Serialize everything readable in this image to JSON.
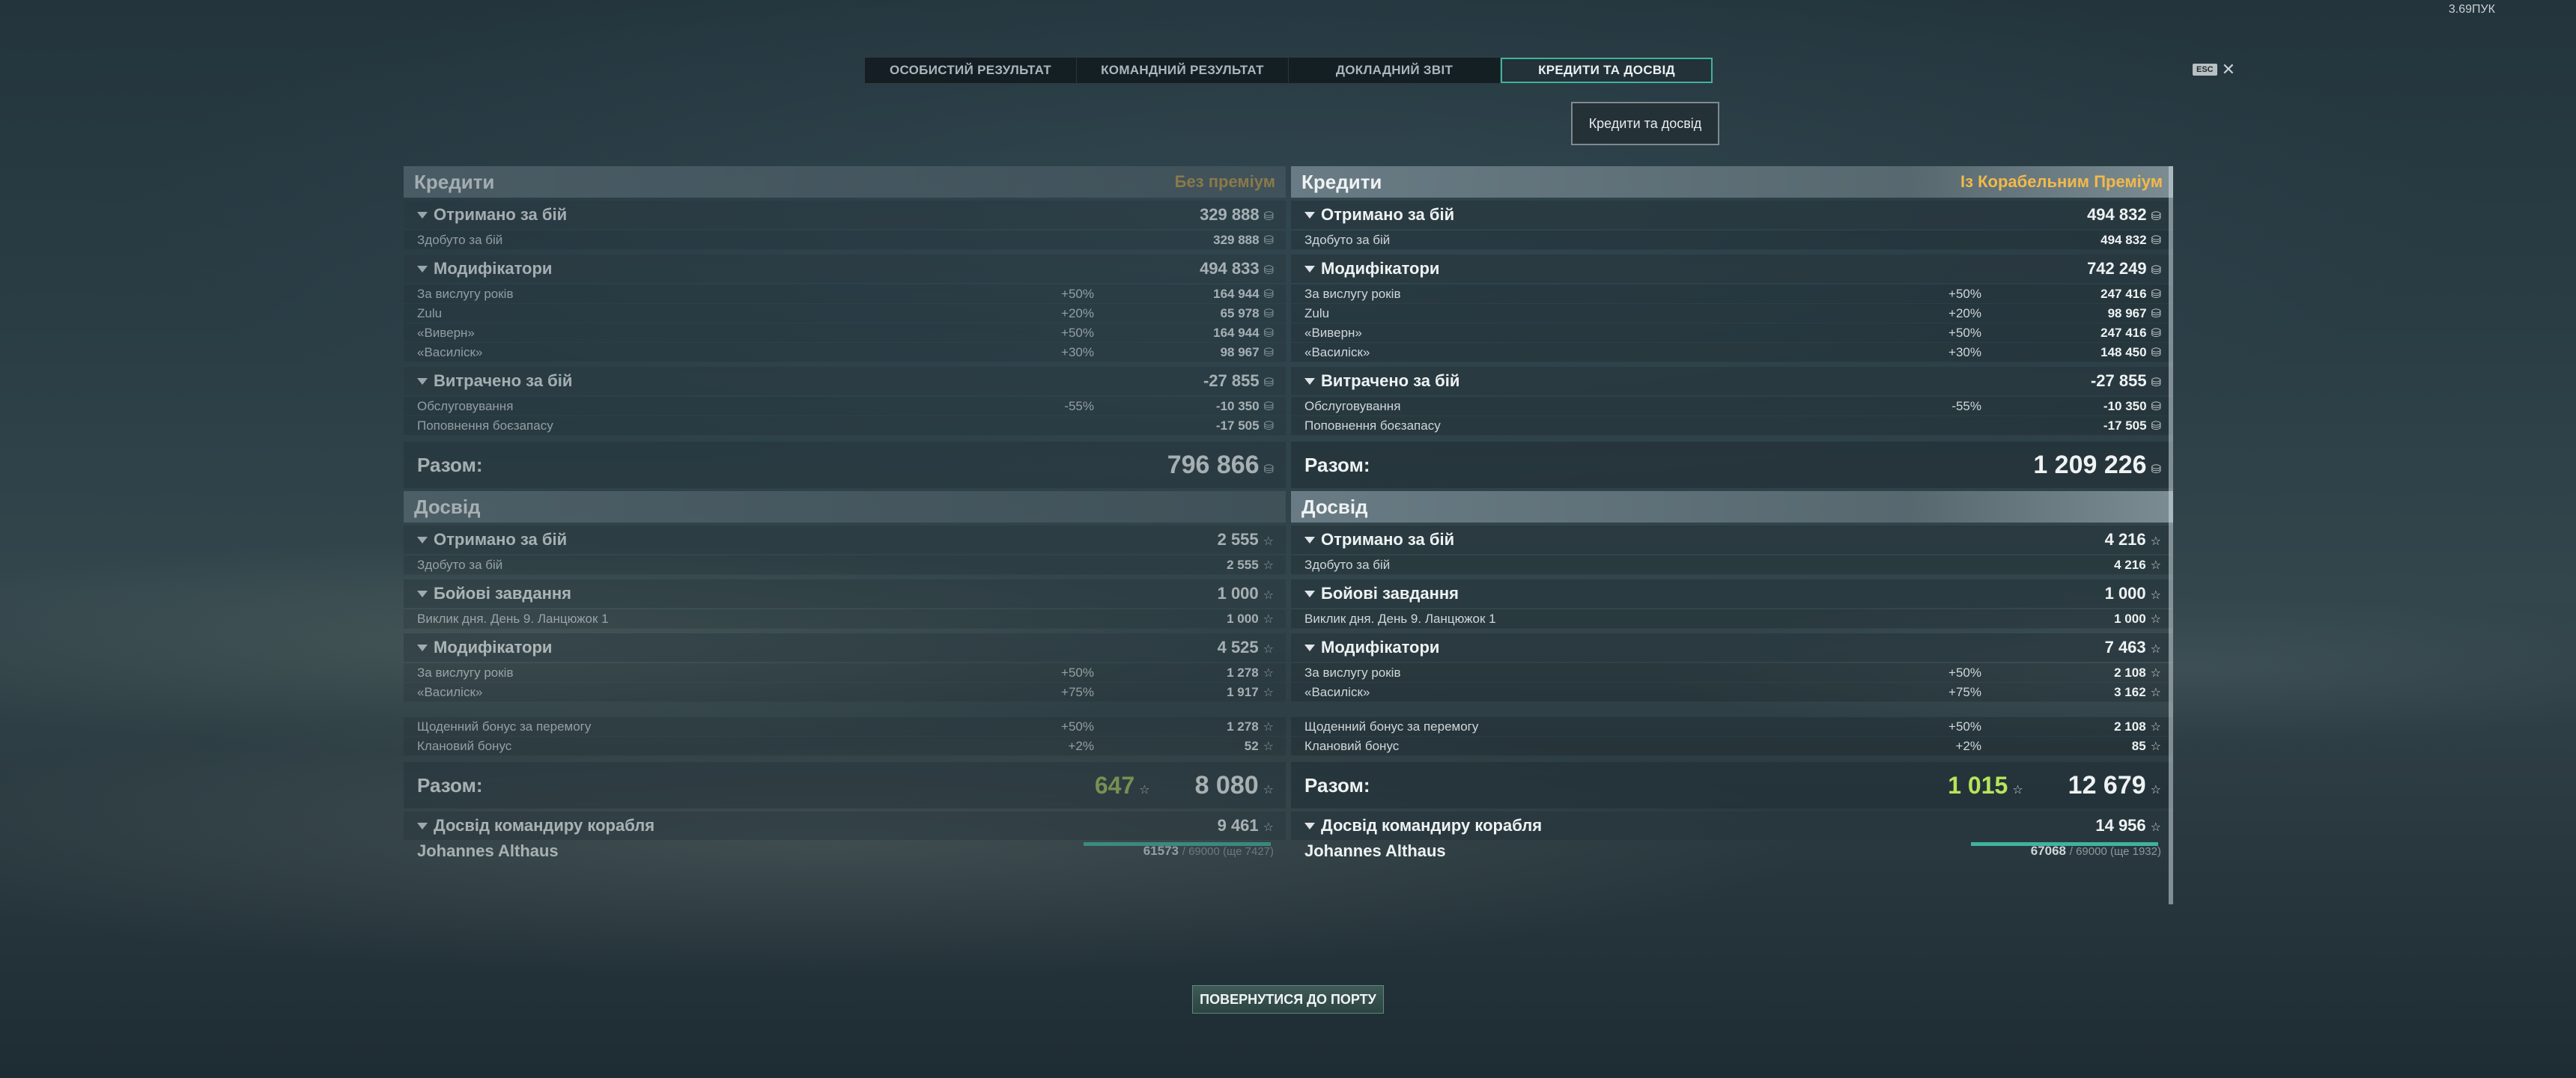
{
  "top_info": "3.69ПУК",
  "tabs": [
    "ОСОБИСТИЙ РЕЗУЛЬТАТ",
    "КОМАНДНИЙ РЕЗУЛЬТАТ",
    "ДОКЛАДНИЙ ЗВІТ",
    "КРЕДИТИ ТА ДОСВІД"
  ],
  "esc": {
    "key": "ESC",
    "close": "✕"
  },
  "credits_exp_button": "Кредити та досвід",
  "back_button": "ПОВЕРНУТИСЯ ДО ПОРТУ",
  "left": {
    "credits_title": "Кредити",
    "premium": "Без преміум",
    "received_label": "Отримано за бій",
    "received_value": "329 888",
    "earned_label": "Здобуто за бій",
    "earned_value": "329 888",
    "modifiers_label": "Модифікатори",
    "modifiers_value": "494 833",
    "mods": [
      {
        "name": "За вислугу років",
        "pct": "+50%",
        "val": "164 944"
      },
      {
        "name": "Zulu",
        "pct": "+20%",
        "val": "65 978"
      },
      {
        "name": "«Виверн»",
        "pct": "+50%",
        "val": "164 944"
      },
      {
        "name": "«Василіск»",
        "pct": "+30%",
        "val": "98 967"
      }
    ],
    "spent_label": "Витрачено за бій",
    "spent_value": "-27 855",
    "spent": [
      {
        "name": "Обслуговування",
        "pct": "-55%",
        "val": "-10 350"
      },
      {
        "name": "Поповнення боєзапасу",
        "pct": "",
        "val": "-17 505"
      }
    ],
    "total_label": "Разом:",
    "total_value": "796 866",
    "exp_title": "Досвід",
    "exp_received_label": "Отримано за бій",
    "exp_received_value": "2 555",
    "exp_earned_label": "Здобуто за бій",
    "exp_earned_value": "2 555",
    "missions_label": "Бойові завдання",
    "missions_value": "1 000",
    "mission_row": {
      "name": "Виклик дня. День 9. Ланцюжок 1",
      "val": "1 000"
    },
    "exp_mods_label": "Модифікатори",
    "exp_mods_value": "4 525",
    "exp_mods": [
      {
        "name": "За вислугу років",
        "pct": "+50%",
        "val": "1 278"
      },
      {
        "name": "«Василіск»",
        "pct": "+75%",
        "val": "1 917"
      }
    ],
    "exp_mods2": [
      {
        "name": "Щоденний бонус за перемогу",
        "pct": "+50%",
        "val": "1 278"
      },
      {
        "name": "Клановий бонус",
        "pct": "+2%",
        "val": "52"
      }
    ],
    "exp_total_label": "Разом:",
    "exp_total_free": "647",
    "exp_total_value": "8 080",
    "captain_label": "Досвід командиру корабля",
    "captain_value": "9 461",
    "captain_name": "Johannes Althaus",
    "captain_progress": "61573",
    "captain_progress_rest": "/ 69000 (ще 7427)"
  },
  "right": {
    "credits_title": "Кредити",
    "premium": "Із Корабельним Преміум",
    "received_label": "Отримано за бій",
    "received_value": "494 832",
    "earned_label": "Здобуто за бій",
    "earned_value": "494 832",
    "modifiers_label": "Модифікатори",
    "modifiers_value": "742 249",
    "mods": [
      {
        "name": "За вислугу років",
        "pct": "+50%",
        "val": "247 416"
      },
      {
        "name": "Zulu",
        "pct": "+20%",
        "val": "98 967"
      },
      {
        "name": "«Виверн»",
        "pct": "+50%",
        "val": "247 416"
      },
      {
        "name": "«Василіск»",
        "pct": "+30%",
        "val": "148 450"
      }
    ],
    "spent_label": "Витрачено за бій",
    "spent_value": "-27 855",
    "spent": [
      {
        "name": "Обслуговування",
        "pct": "-55%",
        "val": "-10 350"
      },
      {
        "name": "Поповнення боєзапасу",
        "pct": "",
        "val": "-17 505"
      }
    ],
    "total_label": "Разом:",
    "total_value": "1 209 226",
    "exp_title": "Досвід",
    "exp_received_label": "Отримано за бій",
    "exp_received_value": "4 216",
    "exp_earned_label": "Здобуто за бій",
    "exp_earned_value": "4 216",
    "missions_label": "Бойові завдання",
    "missions_value": "1 000",
    "mission_row": {
      "name": "Виклик дня. День 9. Ланцюжок 1",
      "val": "1 000"
    },
    "exp_mods_label": "Модифікатори",
    "exp_mods_value": "7 463",
    "exp_mods": [
      {
        "name": "За вислугу років",
        "pct": "+50%",
        "val": "2 108"
      },
      {
        "name": "«Василіск»",
        "pct": "+75%",
        "val": "3 162"
      }
    ],
    "exp_mods2": [
      {
        "name": "Щоденний бонус за перемогу",
        "pct": "+50%",
        "val": "2 108"
      },
      {
        "name": "Клановий бонус",
        "pct": "+2%",
        "val": "85"
      }
    ],
    "exp_total_label": "Разом:",
    "exp_total_free": "1 015",
    "exp_total_value": "12 679",
    "captain_label": "Досвід командиру корабля",
    "captain_value": "14 956",
    "captain_name": "Johannes Althaus",
    "captain_progress": "67068",
    "captain_progress_rest": "/ 69000 (ще 1932)"
  }
}
